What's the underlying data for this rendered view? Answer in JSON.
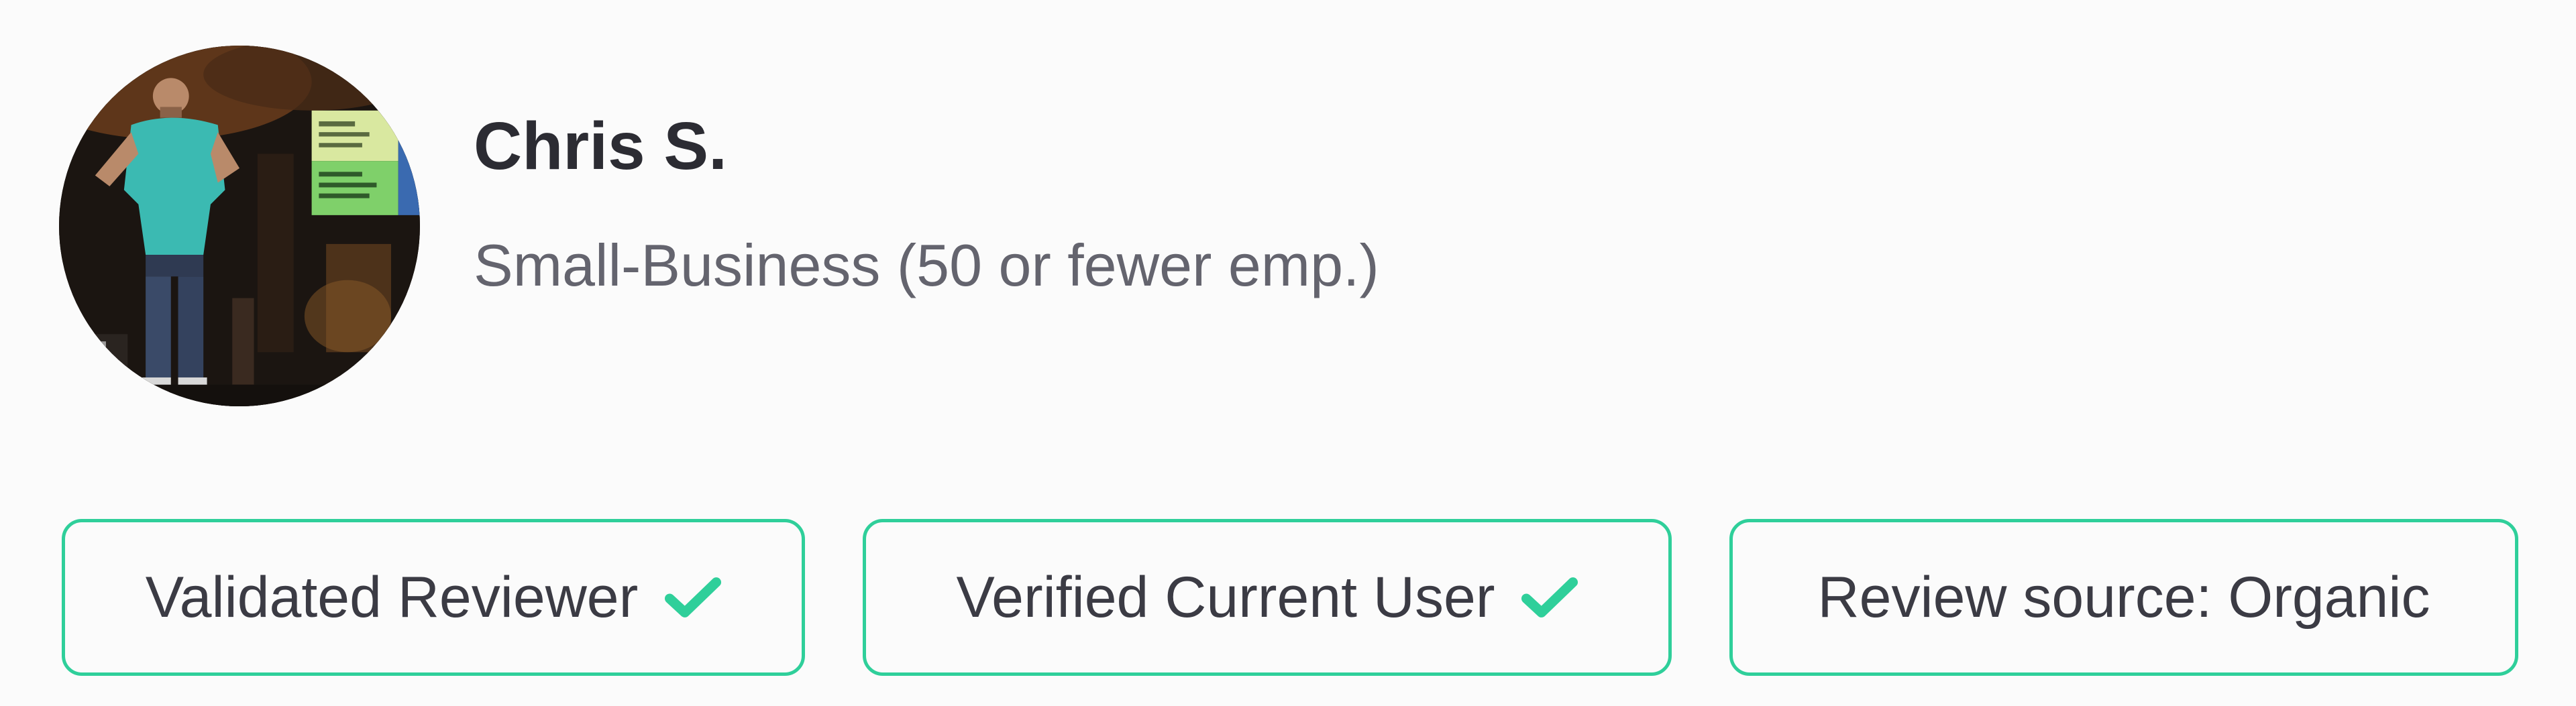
{
  "reviewer": {
    "name": "Chris S.",
    "company_size": "Small-Business (50 or fewer emp.)",
    "avatar_icon": "reviewer-avatar-photo"
  },
  "badges": [
    {
      "label": "Validated Reviewer",
      "verified": true,
      "icon": "checkmark-icon"
    },
    {
      "label": "Verified Current User",
      "verified": true,
      "icon": "checkmark-icon"
    },
    {
      "label": "Review source: Organic",
      "verified": false
    }
  ],
  "colors": {
    "accent_green": "#2fcf9a",
    "name_text": "#2c2c33",
    "secondary_text": "#64646e",
    "background": "#fbfbfb"
  }
}
